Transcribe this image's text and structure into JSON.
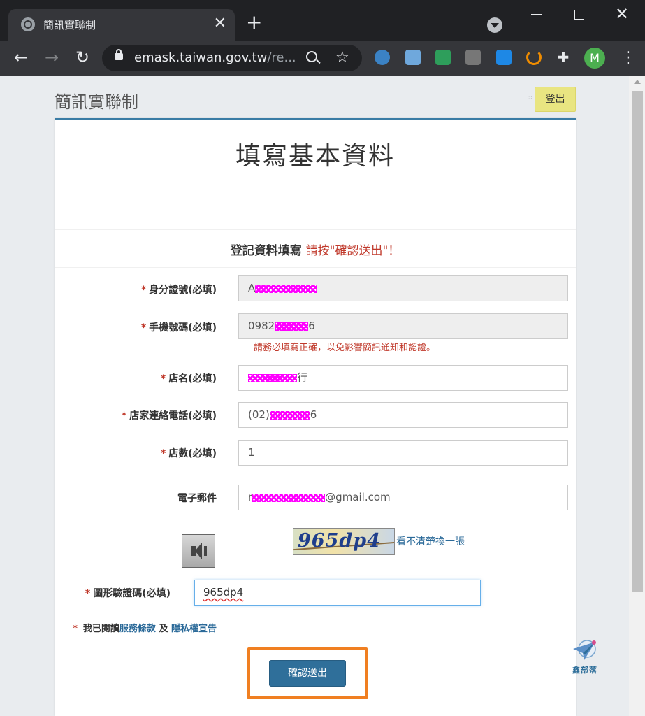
{
  "browser": {
    "tab_title": "簡訊實聯制",
    "url_host": "emask.taiwan.gov.tw",
    "url_path": "/re...",
    "profile_initial": "M",
    "extension_colors": [
      "#3b82c4",
      "#6fa8dc",
      "#2e9e5b",
      "#777777",
      "#1e88e5",
      "#ef8c00"
    ]
  },
  "header": {
    "site_title": "簡訊實聯制",
    "grid_glyph": ":::",
    "logout_label": "登出"
  },
  "form": {
    "title": "填寫基本資料",
    "notice_prefix": "登記資料填寫",
    "notice_red": "請按\"確認送出\"！",
    "required_mark": "*",
    "fields": {
      "id_number": {
        "label": "身分證號(必填)",
        "value_prefix": "A",
        "value_suffix": ""
      },
      "mobile": {
        "label": "手機號碼(必填)",
        "value_prefix": "0982",
        "value_suffix": "6"
      },
      "mobile_hint": "請務必填寫正確，以免影響簡訊通知和認證。",
      "store_name": {
        "label": "店名(必填)",
        "value_prefix": "",
        "value_suffix": "行"
      },
      "store_phone": {
        "label": "店家連絡電話(必填)",
        "value_prefix": "(02)",
        "value_suffix": "6"
      },
      "store_count": {
        "label": "店數(必填)",
        "value": "1"
      },
      "email": {
        "label": "電子郵件",
        "value_prefix": "r",
        "value_suffix": "@gmail.com"
      }
    },
    "captcha": {
      "image_text": "965dp4",
      "refresh_label": "看不清楚換一張",
      "label": "圖形驗證碼(必填)",
      "value": "965dp4"
    },
    "terms": {
      "prefix": "我已閱讀",
      "service_link": "服務條款",
      "conjunction": "及",
      "privacy_link": "隱私權宣告"
    },
    "submit_label": "確認送出"
  },
  "watermark": {
    "text": "鑫部落"
  },
  "colors": {
    "accent": "#2f6f9a",
    "required": "#c0392b",
    "highlight": "#f07f21",
    "logout_bg": "#e9e581"
  }
}
